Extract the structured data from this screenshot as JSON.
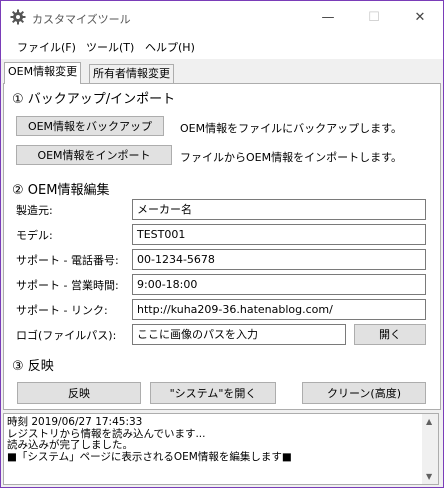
{
  "window": {
    "title": "カスタマイズツール",
    "icon": "gear-icon",
    "controls": {
      "minimize": "—",
      "maximize": "☐",
      "close": "✕"
    }
  },
  "menu": {
    "items": [
      "ファイル(F)",
      "ツール(T)",
      "ヘルプ(H)"
    ]
  },
  "tabs": [
    {
      "label": "OEM情報変更",
      "active": true
    },
    {
      "label": "所有者情報変更",
      "active": false
    }
  ],
  "backup_section": {
    "heading": "① バックアップ/インポート",
    "backup_button": "OEM情報をバックアップ",
    "backup_desc": "OEM情報をファイルにバックアップします。",
    "import_button": "OEM情報をインポート",
    "import_desc": "ファイルからOEM情報をインポートします。"
  },
  "edit_section": {
    "heading": "② OEM情報編集",
    "fields": [
      {
        "label": "製造元:",
        "value": "メーカー名"
      },
      {
        "label": "モデル:",
        "value": "TEST001"
      },
      {
        "label": "サポート - 電話番号:",
        "value": "00-1234-5678"
      },
      {
        "label": "サポート - 営業時間:",
        "value": "9:00-18:00"
      },
      {
        "label": "サポート - リンク:",
        "value": "http://kuha209-36.hatenablog.com/"
      },
      {
        "label": "ロゴ(ファイルパス):",
        "value": "ここに画像のパスを入力"
      }
    ],
    "open_button": "開く"
  },
  "apply_section": {
    "heading": "③ 反映",
    "apply_button": "反映",
    "open_system_button": "\"システム\"を開く",
    "cleanup_button": "クリーン(高度)"
  },
  "log": {
    "lines": [
      "時刻 2019/06/27 17:45:33",
      "レジストリから情報を読み込んでいます...",
      "読み込みが完了しました。",
      "■「システム」ページに表示されるOEM情報を編集します■"
    ]
  }
}
